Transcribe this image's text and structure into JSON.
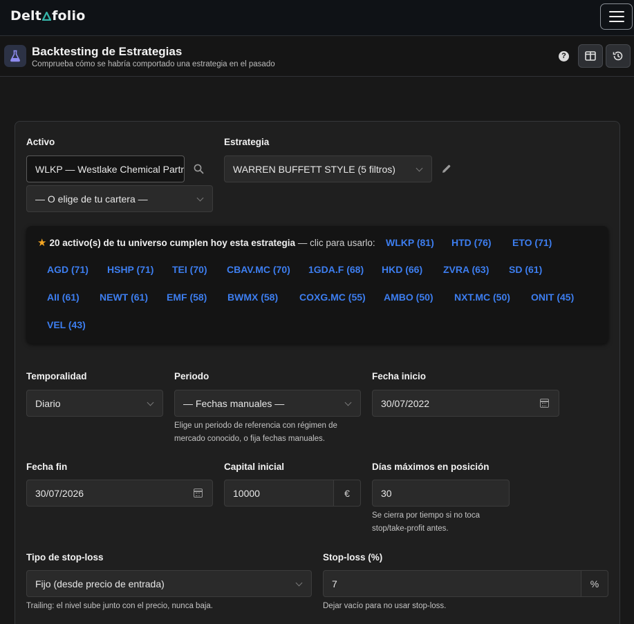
{
  "app": {
    "brand_left": "Delt",
    "brand_right": "folio"
  },
  "page": {
    "title": "Backtesting de Estrategias",
    "subtitle": "Comprueba cómo se habría comportado una estrategia en el pasado",
    "help_label": "?"
  },
  "form": {
    "activo": {
      "label": "Activo",
      "value": "WLKP — Westlake Chemical Partn",
      "portfolio_select": "— O elige de tu cartera —"
    },
    "estrategia": {
      "label": "Estrategia",
      "value": "WARREN BUFFETT STYLE (5 filtros)"
    },
    "suggestions": {
      "count_text": "20 activo(s) de tu universo cumplen hoy esta estrategia",
      "cta_text": "— clic para usarlo:",
      "items": [
        "WLKP (81)",
        "HTD (76)",
        "ETO (71)",
        "AGD (71)",
        "HSHP (71)",
        "TEI (70)",
        "CBAV.MC (70)",
        "1GDA.F (68)",
        "HKD (66)",
        "ZVRA (63)",
        "SD (61)",
        "AII (61)",
        "NEWT (61)",
        "EMF (58)",
        "BWMX (58)",
        "COXG.MC (55)",
        "AMBO (50)",
        "NXT.MC (50)",
        "ONIT (45)",
        "VEL (43)"
      ]
    },
    "temporalidad": {
      "label": "Temporalidad",
      "value": "Diario"
    },
    "periodo": {
      "label": "Periodo",
      "value": "— Fechas manuales —",
      "hint": "Elige un periodo de referencia con régimen de mercado conocido, o fija fechas manuales."
    },
    "fecha_inicio": {
      "label": "Fecha inicio",
      "value": "30/07/2022"
    },
    "fecha_fin": {
      "label": "Fecha fin",
      "value": "30/07/2026"
    },
    "capital": {
      "label": "Capital inicial",
      "value": "10000",
      "unit": "€"
    },
    "dias_max": {
      "label": "Días máximos en posición",
      "value": "30",
      "hint": "Se cierra por tiempo si no toca stop/take-profit antes."
    },
    "stop_tipo": {
      "label": "Tipo de stop-loss",
      "value": "Fijo (desde precio de entrada)",
      "hint": "Trailing: el nivel sube junto con el precio, nunca baja."
    },
    "stop_pct": {
      "label": "Stop-loss (%)",
      "value": "7",
      "unit": "%",
      "hint": "Dejar vacío para no usar stop-loss."
    }
  },
  "colors": {
    "accent": "#36b3a8",
    "link": "#3d7ef0",
    "star": "#f5a623"
  }
}
